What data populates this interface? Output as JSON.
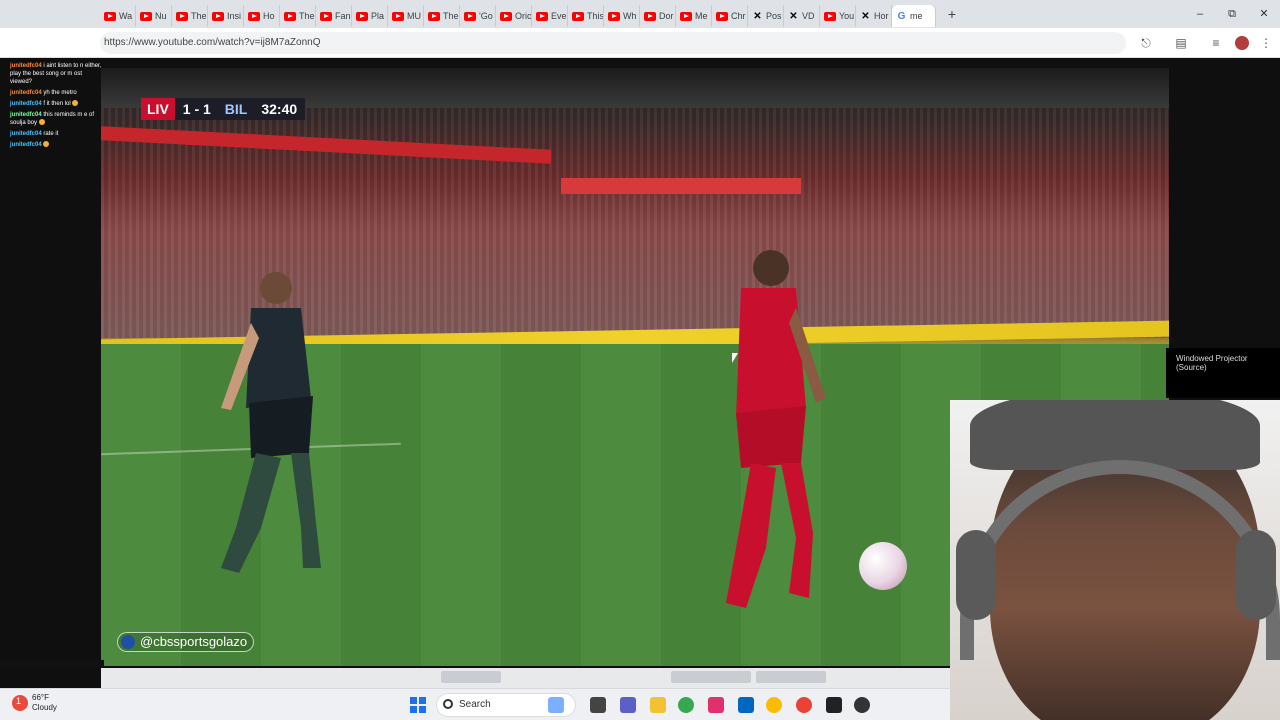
{
  "browser": {
    "tabs": [
      {
        "label": "Wa",
        "icon": "youtube-icon"
      },
      {
        "label": "Nu",
        "icon": "youtube-icon"
      },
      {
        "label": "The",
        "icon": "youtube-icon"
      },
      {
        "label": "Insi",
        "icon": "youtube-icon"
      },
      {
        "label": "Ho",
        "icon": "youtube-icon"
      },
      {
        "label": "The",
        "icon": "youtube-icon"
      },
      {
        "label": "Fan",
        "icon": "youtube-icon"
      },
      {
        "label": "Pla",
        "icon": "youtube-icon"
      },
      {
        "label": "MU",
        "icon": "youtube-icon"
      },
      {
        "label": "The",
        "icon": "youtube-icon"
      },
      {
        "label": "'Go",
        "icon": "youtube-icon"
      },
      {
        "label": "Oric",
        "icon": "youtube-icon"
      },
      {
        "label": "Eve",
        "icon": "youtube-icon"
      },
      {
        "label": "This",
        "icon": "youtube-icon"
      },
      {
        "label": "Wh",
        "icon": "youtube-icon"
      },
      {
        "label": "Dor",
        "icon": "youtube-icon"
      },
      {
        "label": "Me",
        "icon": "youtube-icon"
      },
      {
        "label": "Chr",
        "icon": "youtube-icon"
      },
      {
        "label": "Pos",
        "icon": "x-icon"
      },
      {
        "label": "VD",
        "icon": "x-icon"
      },
      {
        "label": "You",
        "icon": "youtube-icon"
      },
      {
        "label": "Hor",
        "icon": "x-icon"
      },
      {
        "label": "me",
        "icon": "google-icon",
        "active": true
      }
    ],
    "new_tab": "+",
    "url": "https://www.youtube.com/watch?v=ij8M7aZonnQ"
  },
  "chat": {
    "messages": [
      {
        "user": "junitedfc04",
        "text": "i aint listen to n either, play the best song or m ost viewed?"
      },
      {
        "user": "junitedfc04",
        "text": "yh the metro"
      },
      {
        "user": "junitedfc04",
        "text": "f it then lol"
      },
      {
        "user": "junitedfc04",
        "text": "this reminds m e of soulja boy"
      },
      {
        "user": "junitedfc04",
        "text": "rate it"
      },
      {
        "user": "junitedfc04",
        "text": ""
      }
    ]
  },
  "video": {
    "scoreboard": {
      "home": "LIV",
      "score": "1 - 1",
      "away": "BIL",
      "clock": "32:40"
    },
    "watermark": "@cbssportsgolazo"
  },
  "projector_label": "Windowed Projector (Source)",
  "taskbar": {
    "temperature": "66°F",
    "condition": "Cloudy",
    "weather_badge": "1",
    "search_label": "Search"
  }
}
